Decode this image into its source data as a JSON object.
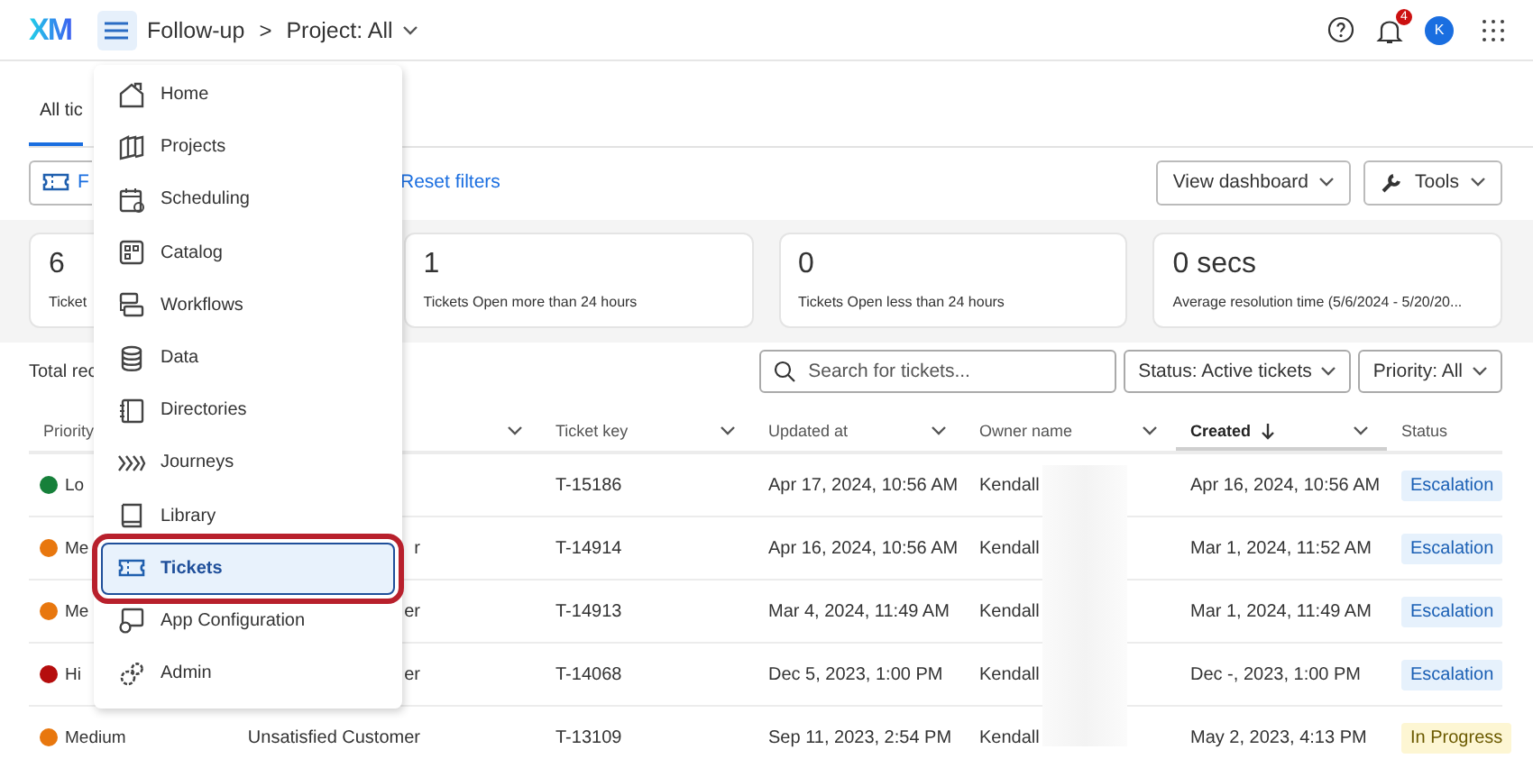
{
  "header": {
    "logo": "XM",
    "breadcrumb": [
      "Follow-up",
      "Project: All"
    ],
    "separator": ">",
    "notification_count": "4",
    "avatar": "K"
  },
  "tabs": [
    {
      "label": "All tic",
      "selected": true
    }
  ],
  "toolbar": {
    "filter_button": "F",
    "reset_link": "Reset filters",
    "view_dashboard": "View dashboard",
    "tools": "Tools"
  },
  "stats": [
    {
      "value": "6",
      "label": "Ticket"
    },
    {
      "value": "1",
      "label": "Tickets Open more than 24 hours"
    },
    {
      "value": "0",
      "label": "Tickets Open less than 24 hours"
    },
    {
      "value": "0 secs",
      "label": "Average resolution time (5/6/2024 - 5/20/20..."
    }
  ],
  "total_label": "Total rec",
  "search": {
    "placeholder": "Search for tickets..."
  },
  "filters": [
    "Status: Active tickets",
    "Priority: All"
  ],
  "table": {
    "columns": [
      {
        "label": "Priority",
        "sorted": false
      },
      {
        "has_menu": true,
        "sorted": false
      },
      {
        "label": "Ticket key",
        "has_menu": true,
        "sorted": false
      },
      {
        "label": "Updated at",
        "has_menu": true,
        "sorted": false
      },
      {
        "label": "Owner name",
        "has_menu": true,
        "sorted": false
      },
      {
        "label": "Created",
        "has_menu": true,
        "sorted": true
      },
      {
        "label": "Status",
        "has_menu": false,
        "sorted": false
      }
    ],
    "rows": [
      {
        "priority": "Lo",
        "color": "#16803a",
        "ticket_key": "T-15186",
        "updated_at": "Apr 17, 2024, 10:56 AM",
        "owner": "Kendall",
        "created": "Apr 16, 2024, 10:56 AM",
        "status": {
          "label": "Escalation",
          "kind": "escalation"
        }
      },
      {
        "priority": "Me",
        "color": "#e8770e",
        "column_2": "r",
        "ticket_key": "T-14914",
        "updated_at": "Apr 16, 2024, 10:56 AM",
        "owner": "Kendall",
        "created": "Mar 1, 2024, 11:52 AM",
        "status": {
          "label": "Escalation",
          "kind": "escalation"
        }
      },
      {
        "priority": "Me",
        "color": "#e8770e",
        "column_2": "er",
        "ticket_key": "T-14913",
        "updated_at": "Mar 4, 2024, 11:49 AM",
        "owner": "Kendall",
        "created": "Mar 1, 2024, 11:49 AM",
        "status": {
          "label": "Escalation",
          "kind": "escalation"
        }
      },
      {
        "priority": "Hi",
        "color": "#b50d0d",
        "column_2": "er",
        "ticket_key": "T-14068",
        "updated_at": "Dec 5, 2023, 1:00 PM",
        "owner": "Kendall",
        "created": "Dec -, 2023, 1:00 PM",
        "status": {
          "label": "Escalation",
          "kind": "escalation"
        }
      },
      {
        "priority": "Medium",
        "color": "#e8770e",
        "column_2": "Unsatisfied Customer",
        "ticket_key": "T-13109",
        "updated_at": "Sep 11, 2023, 2:54 PM",
        "owner": "Kendall",
        "created": "May 2, 2023, 4:13 PM",
        "status": {
          "label": "In Progress",
          "kind": "progress"
        }
      }
    ]
  },
  "menu": [
    {
      "label": "Home",
      "selected": false,
      "highlighted": false
    },
    {
      "label": "Projects",
      "selected": false,
      "highlighted": false
    },
    {
      "label": "Scheduling",
      "selected": false,
      "highlighted": false
    },
    {
      "label": "Catalog",
      "selected": false,
      "highlighted": false
    },
    {
      "label": "Workflows",
      "selected": false,
      "highlighted": false
    },
    {
      "label": "Data",
      "selected": false,
      "highlighted": false
    },
    {
      "label": "Directories",
      "selected": false,
      "highlighted": false
    },
    {
      "label": "Journeys",
      "selected": false,
      "highlighted": false
    },
    {
      "label": "Library",
      "selected": false,
      "highlighted": false
    },
    {
      "label": "Tickets",
      "selected": true,
      "highlighted": true
    },
    {
      "label": "App Configuration",
      "selected": false,
      "highlighted": false
    },
    {
      "label": "Admin",
      "selected": false,
      "highlighted": false
    }
  ]
}
